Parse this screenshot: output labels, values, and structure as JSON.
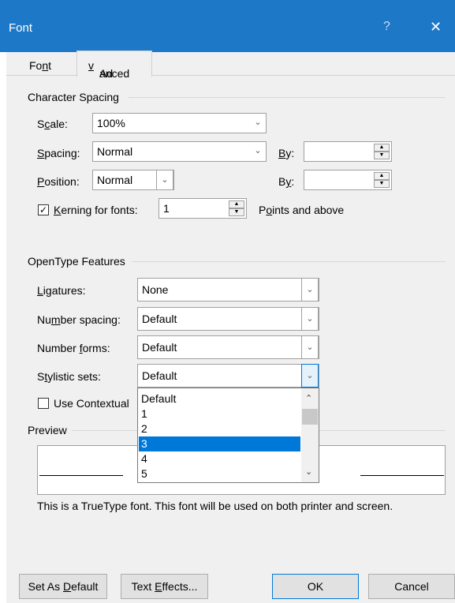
{
  "window": {
    "title": "Font",
    "help": "?",
    "close": "✕"
  },
  "tabs": [
    {
      "label_pre": "Fo",
      "label_u": "n",
      "label_post": "t"
    },
    {
      "label_pre": "Ad",
      "label_u": "v",
      "label_post": "anced"
    }
  ],
  "character_spacing": {
    "title": "Character Spacing",
    "scale": {
      "label_pre": "S",
      "label_u": "c",
      "label_post": "ale:",
      "value": "100%"
    },
    "spacing": {
      "label_pre": "",
      "label_u": "S",
      "label_post": "pacing:",
      "value": "Normal",
      "by_pre": "",
      "by_u": "B",
      "by_post": "y:",
      "by_value": ""
    },
    "position": {
      "label_pre": "",
      "label_u": "P",
      "label_post": "osition:",
      "value": "Normal",
      "by_pre": "B",
      "by_u": "y",
      "by_post": ":",
      "by_value": ""
    },
    "kerning": {
      "checked": true,
      "label_pre": "",
      "label_u": "K",
      "label_post": "erning for fonts:",
      "value": "1",
      "after_pre": "P",
      "after_u": "o",
      "after_post": "ints and above"
    }
  },
  "opentype": {
    "title": "OpenType Features",
    "ligatures": {
      "label_pre": "",
      "label_u": "L",
      "label_post": "igatures:",
      "value": "None"
    },
    "number_spacing": {
      "label_pre": "Nu",
      "label_u": "m",
      "label_post": "ber spacing:",
      "value": "Default"
    },
    "number_forms": {
      "label_pre": "Number ",
      "label_u": "f",
      "label_post": "orms:",
      "value": "Default"
    },
    "stylistic_sets": {
      "label_pre": "S",
      "label_u": "t",
      "label_post": "ylistic sets:",
      "value": "Default"
    },
    "contextual": {
      "checked": false,
      "label": "Use Contextual"
    },
    "dropdown_options": [
      "Default",
      "1",
      "2",
      "3",
      "4",
      "5"
    ],
    "selected_option": "3"
  },
  "preview": {
    "title": "Preview",
    "note": "This is a TrueType font. This font will be used on both printer and screen."
  },
  "buttons": {
    "set_default_pre": "Set As ",
    "set_default_u": "D",
    "set_default_post": "efault",
    "text_effects_pre": "Text ",
    "text_effects_u": "E",
    "text_effects_post": "ffects...",
    "ok": "OK",
    "cancel": "Cancel"
  },
  "colors": {
    "titlebar": "#1e78c8",
    "selection": "#0078d7"
  }
}
